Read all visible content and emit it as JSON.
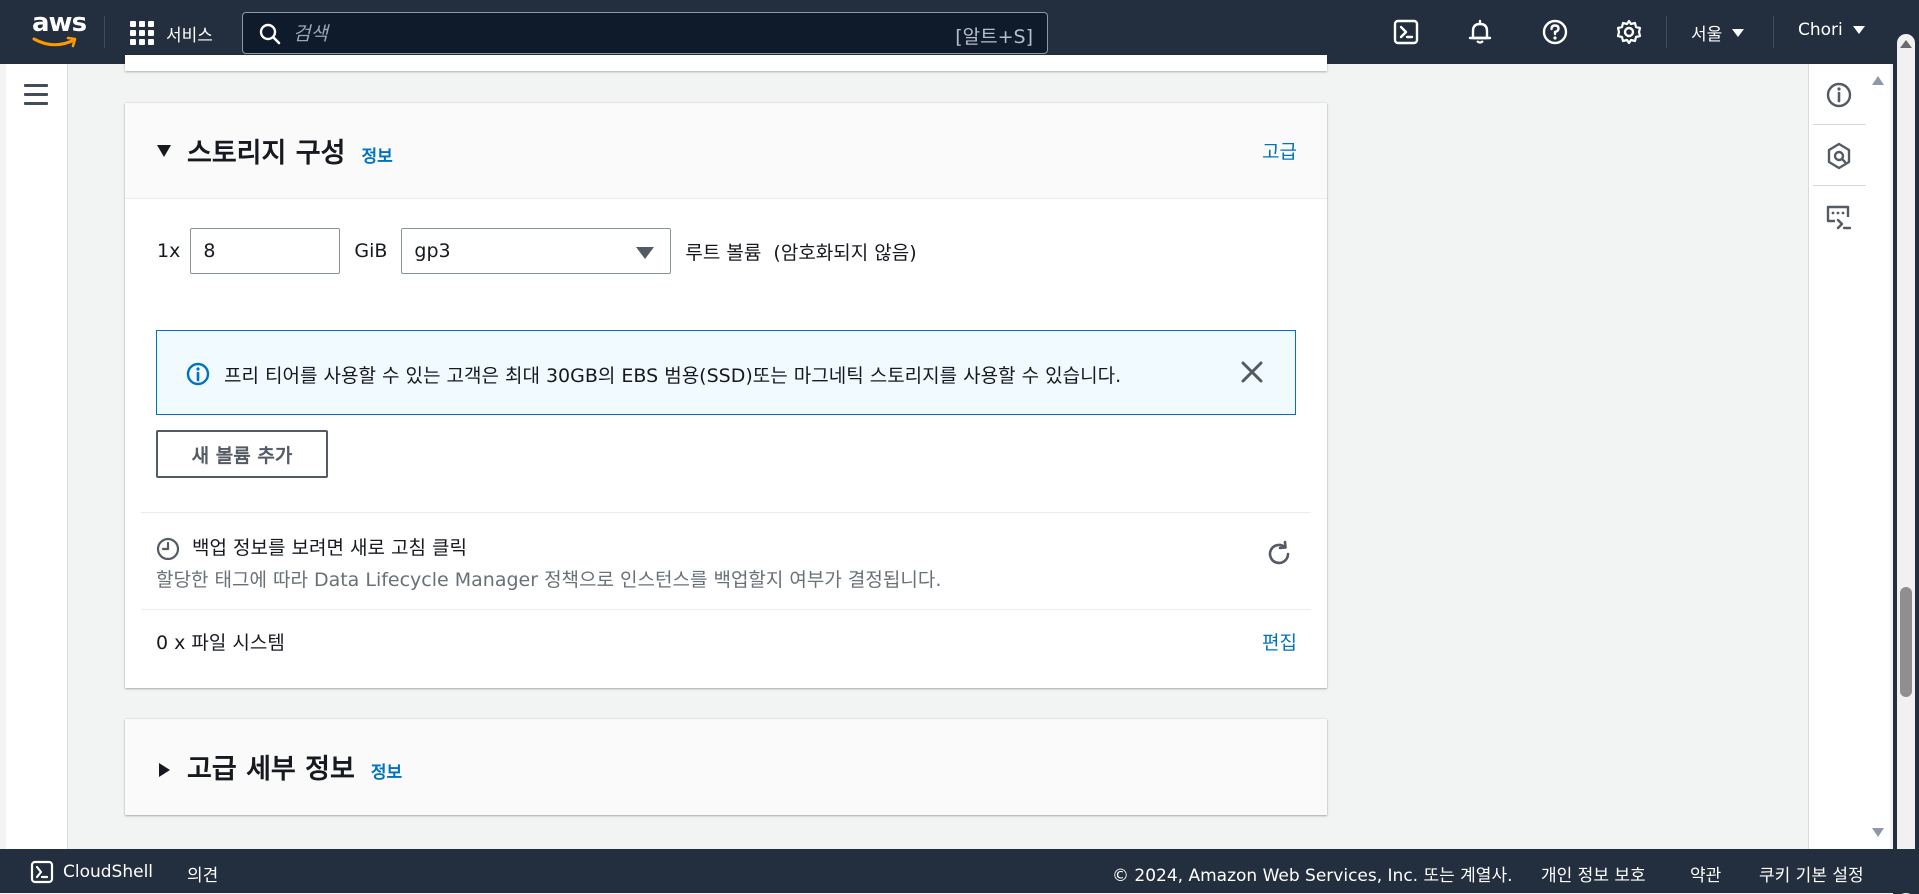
{
  "topnav": {
    "logo_text": "aws",
    "services_label": "서비스",
    "search_placeholder": "검색",
    "search_shortcut": "[알트+S]",
    "region_label": "서울",
    "account_label": "Chori"
  },
  "storage_section": {
    "title": "스토리지 구성",
    "info_link": "정보",
    "advanced_link": "고급",
    "volume_count": "1x",
    "volume_size": "8",
    "volume_unit": "GiB",
    "volume_type": "gp3",
    "volume_description": "루트 볼륨  (암호화되지 않음)",
    "alert_message": "프리 티어를 사용할 수 있는 고객은 최대 30GB의 EBS 범용(SSD)또는 마그네틱 스토리지를 사용할 수 있습니다.",
    "add_volume_button": "새 볼륨 추가",
    "backup_title": "백업 정보를 보려면 새로 고침 클릭",
    "backup_description": "할당한 태그에 따라 Data Lifecycle Manager 정책으로 인스턴스를 백업할지 여부가 결정됩니다.",
    "file_systems_label": "0 x 파일 시스템",
    "edit_link": "편집"
  },
  "advanced_section": {
    "title": "고급 세부 정보",
    "info_link": "정보"
  },
  "footer": {
    "cloudshell": "CloudShell",
    "feedback": "의견",
    "copyright": "© 2024, Amazon Web Services, Inc. 또는 계열사.",
    "privacy": "개인 정보 보호",
    "terms": "약관",
    "cookie_settings": "쿠키 기본 설정"
  },
  "colors": {
    "nav_bg": "#232f3e",
    "link": "#0073bb",
    "alert_bg": "#f1faff",
    "alert_border": "#0073bb"
  }
}
